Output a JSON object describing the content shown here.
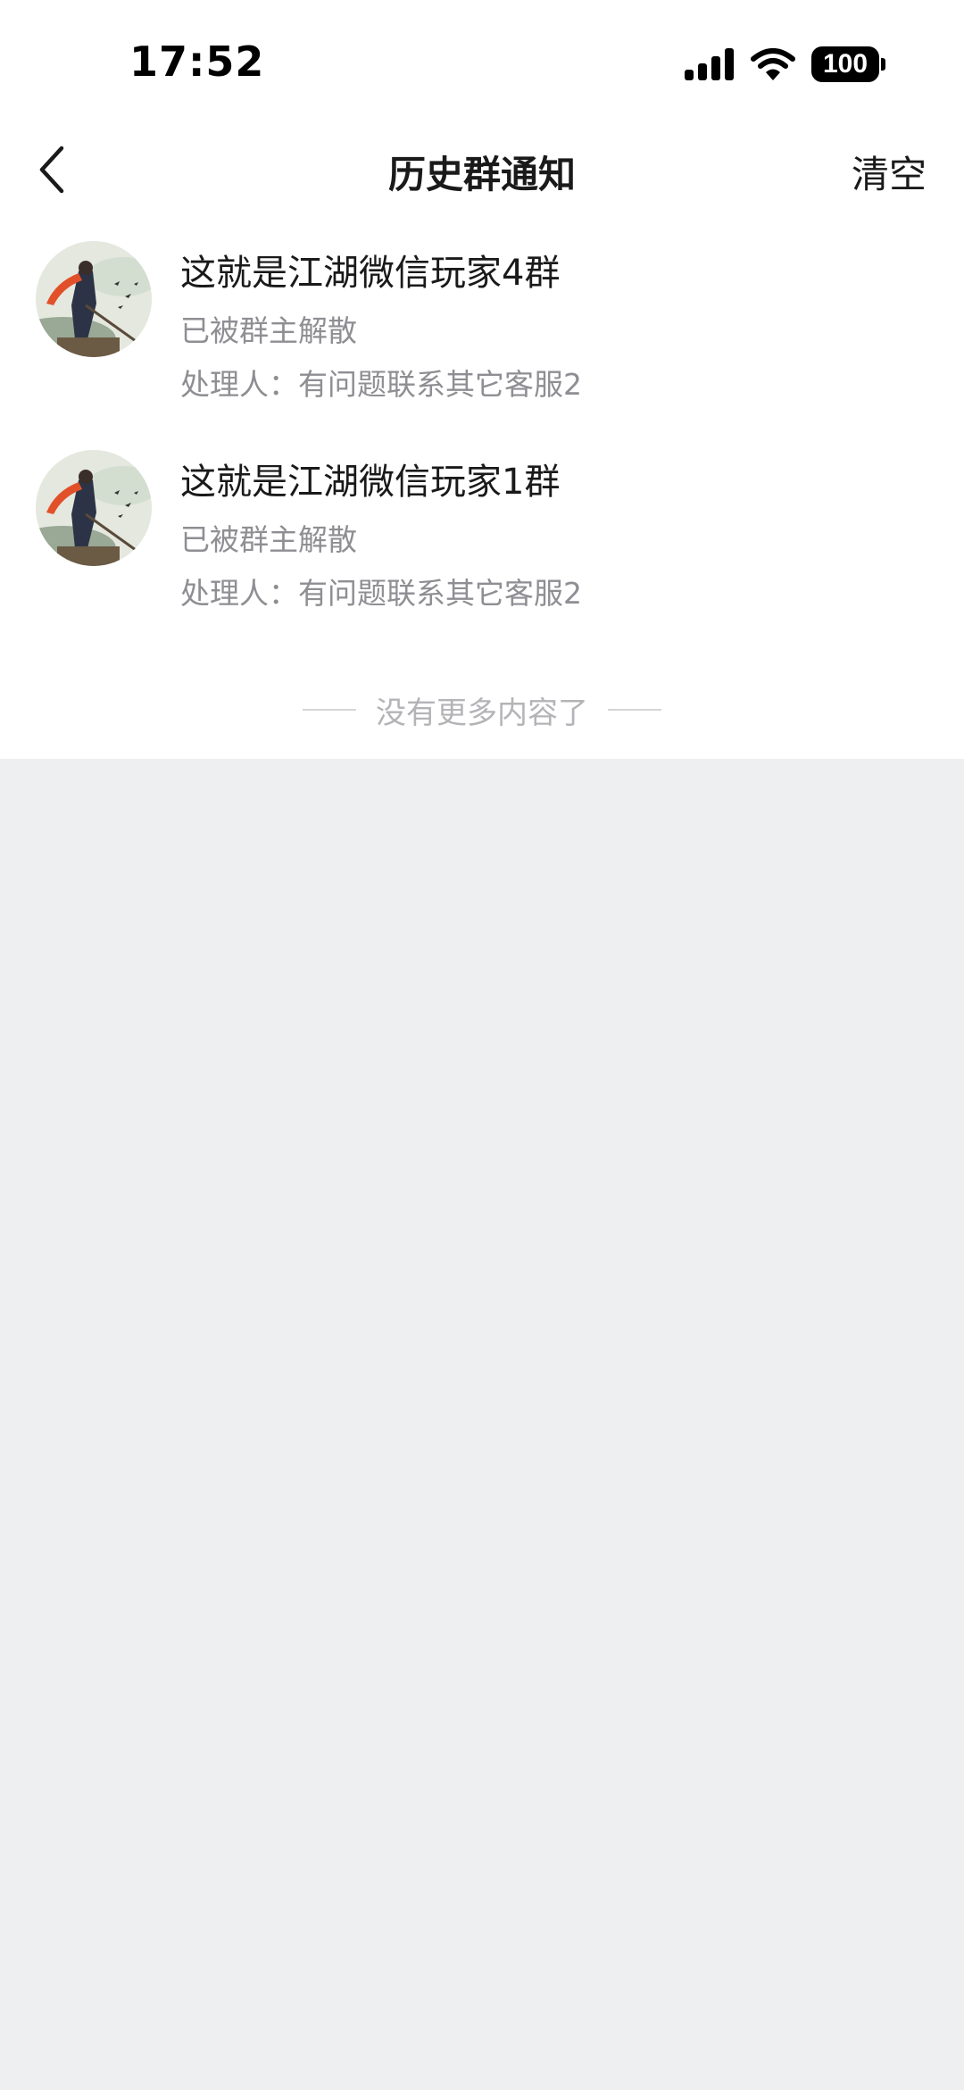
{
  "status_bar": {
    "time": "17:52",
    "battery": "100",
    "icons": [
      "cellular-signal-icon",
      "wifi-icon",
      "battery-icon"
    ]
  },
  "nav": {
    "title": "历史群通知",
    "action_label": "清空",
    "back_icon": "chevron-left-icon"
  },
  "notices": [
    {
      "group_name": "这就是江湖微信玩家4群",
      "status": "已被群主解散",
      "handler": "处理人：有问题联系其它客服2"
    },
    {
      "group_name": "这就是江湖微信玩家1群",
      "status": "已被群主解散",
      "handler": "处理人：有问题联系其它客服2"
    }
  ],
  "footer": {
    "end_text": "没有更多内容了"
  },
  "colors": {
    "page_background": "#eeeff1",
    "content_background": "#ffffff",
    "primary_text": "#1a1a1a",
    "secondary_text": "#8e8e93",
    "muted_text": "#b4b4b8"
  }
}
